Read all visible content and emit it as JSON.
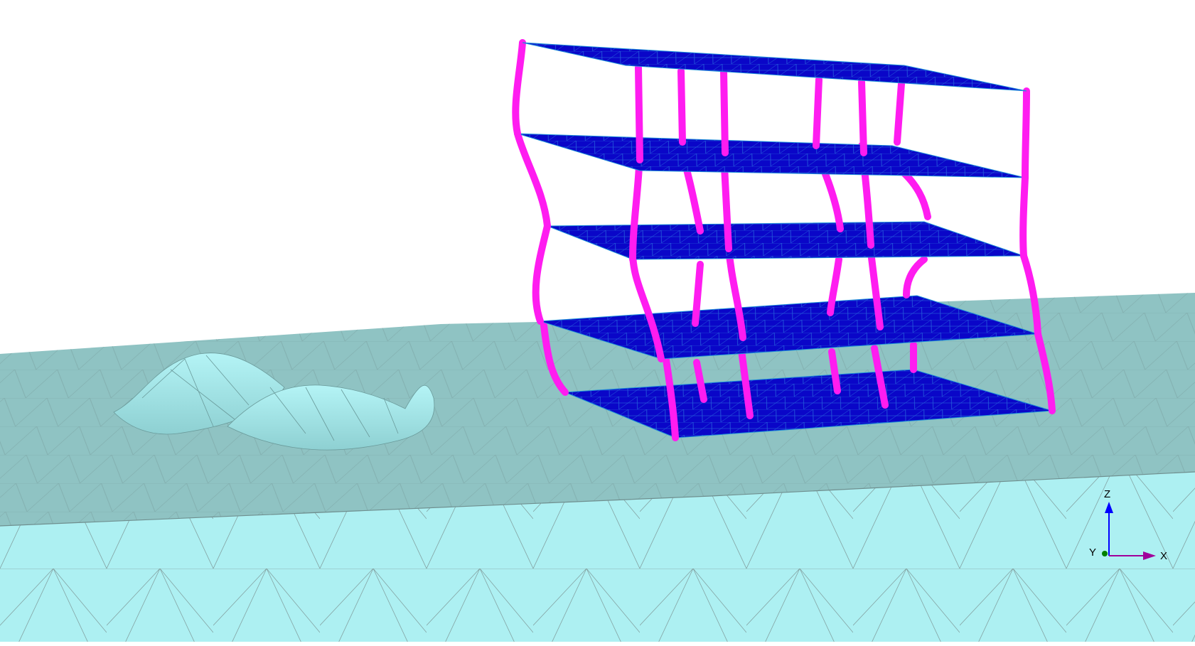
{
  "scene": {
    "description_hidden": "",
    "colors": {
      "background": "#ffffff",
      "soil_top": "#8fc3c3",
      "soil_side": "#adf0f2",
      "soil_mesh": "#6f8f8f",
      "slab_fill": "#0a06c8",
      "slab_mesh": "#1a8fd8",
      "column": "#ff1cf0",
      "axis_z": "#0000ff",
      "axis_x": "#a0009a",
      "axis_y": "#008000"
    },
    "icons": {
      "triad": "axis-triad-icon"
    }
  },
  "axis_triad": {
    "z_label": "Z",
    "x_label": "X",
    "y_label": "Y"
  }
}
